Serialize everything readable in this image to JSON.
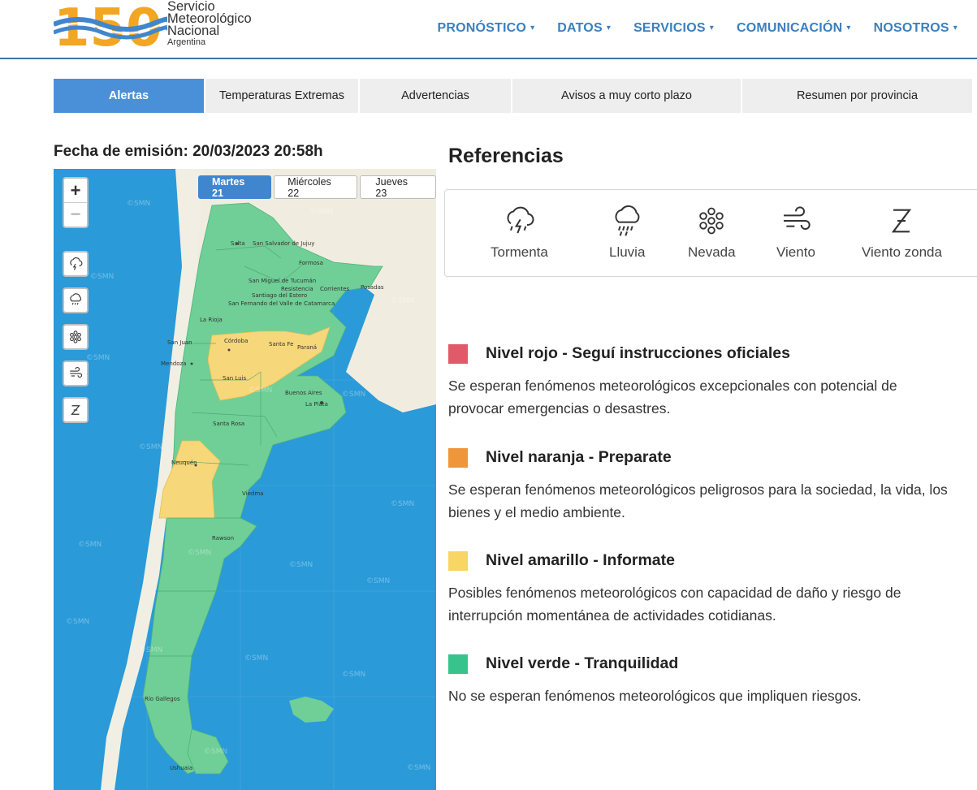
{
  "header": {
    "logo_number": "150",
    "logo_line1": "Servicio",
    "logo_line2": "Meteorológico",
    "logo_line3": "Nacional",
    "logo_line4": "Argentina",
    "nav": [
      {
        "label": "PRONÓSTICO"
      },
      {
        "label": "DATOS"
      },
      {
        "label": "SERVICIOS"
      },
      {
        "label": "COMUNICACIÓN"
      },
      {
        "label": "NOSOTROS"
      }
    ],
    "caret": "▾"
  },
  "tabs": [
    {
      "label": "Alertas",
      "active": true
    },
    {
      "label": "Temperaturas Extremas"
    },
    {
      "label": "Advertencias"
    },
    {
      "label": "Avisos a muy corto plazo"
    },
    {
      "label": "Resumen por provincia"
    }
  ],
  "fecha": {
    "label": "Fecha de emisión:",
    "value": "20/03/2023 20:58h"
  },
  "map": {
    "zoom_in": "+",
    "zoom_out": "−",
    "days": [
      {
        "label": "Martes 21",
        "active": true
      },
      {
        "label": "Miércoles 22"
      },
      {
        "label": "Jueves 23"
      }
    ],
    "watermark": "©SMN",
    "colors": {
      "ocean": "#2a9ad8",
      "land": "#f0ede0",
      "green": "#6fcf97",
      "yellow": "#f6d77a",
      "chile": "#f1efe3"
    },
    "cities": [
      "Salta",
      "San Salvador de Jujuy",
      "Formosa",
      "San Miguel de Tucumán",
      "Resistencia",
      "Corrientes",
      "Posadas",
      "Santiago del Estero",
      "San Fernando del Valle de Catamarca",
      "La Rioja",
      "San Juan",
      "Córdoba",
      "Santa Fe",
      "Paraná",
      "Mendoza",
      "San Luis",
      "Buenos Aires",
      "La Plata",
      "Santa Rosa",
      "Neuquén",
      "Viedma",
      "Rawson",
      "Río Gallegos",
      "Ushuaia"
    ]
  },
  "references": {
    "title": "Referencias",
    "items": [
      {
        "label": "Tormenta",
        "icon": "storm-icon"
      },
      {
        "label": "Lluvia",
        "icon": "rain-icon"
      },
      {
        "label": "Nevada",
        "icon": "snowflake-icon"
      },
      {
        "label": "Viento",
        "icon": "wind-icon"
      },
      {
        "label": "Viento zonda",
        "icon": "zonda-icon"
      }
    ]
  },
  "levels": [
    {
      "title": "Nivel rojo - Seguí instrucciones oficiales",
      "desc": "Se esperan fenómenos meteorológicos excepcionales con potencial de provocar emergencias o desastres.",
      "color": "#e05a6a"
    },
    {
      "title": "Nivel naranja - Preparate",
      "desc": "Se esperan fenómenos meteorológicos peligrosos para la sociedad, la vida, los bienes y el medio ambiente.",
      "color": "#f0963a"
    },
    {
      "title": "Nivel amarillo - Informate",
      "desc": "Posibles fenómenos meteorológicos con capacidad de daño y riesgo de interrupción momentánea de actividades cotidianas.",
      "color": "#f9d564"
    },
    {
      "title": "Nivel verde - Tranquilidad",
      "desc": "No se esperan fenómenos meteorológicos que impliquen riesgos.",
      "color": "#37c48c"
    }
  ]
}
